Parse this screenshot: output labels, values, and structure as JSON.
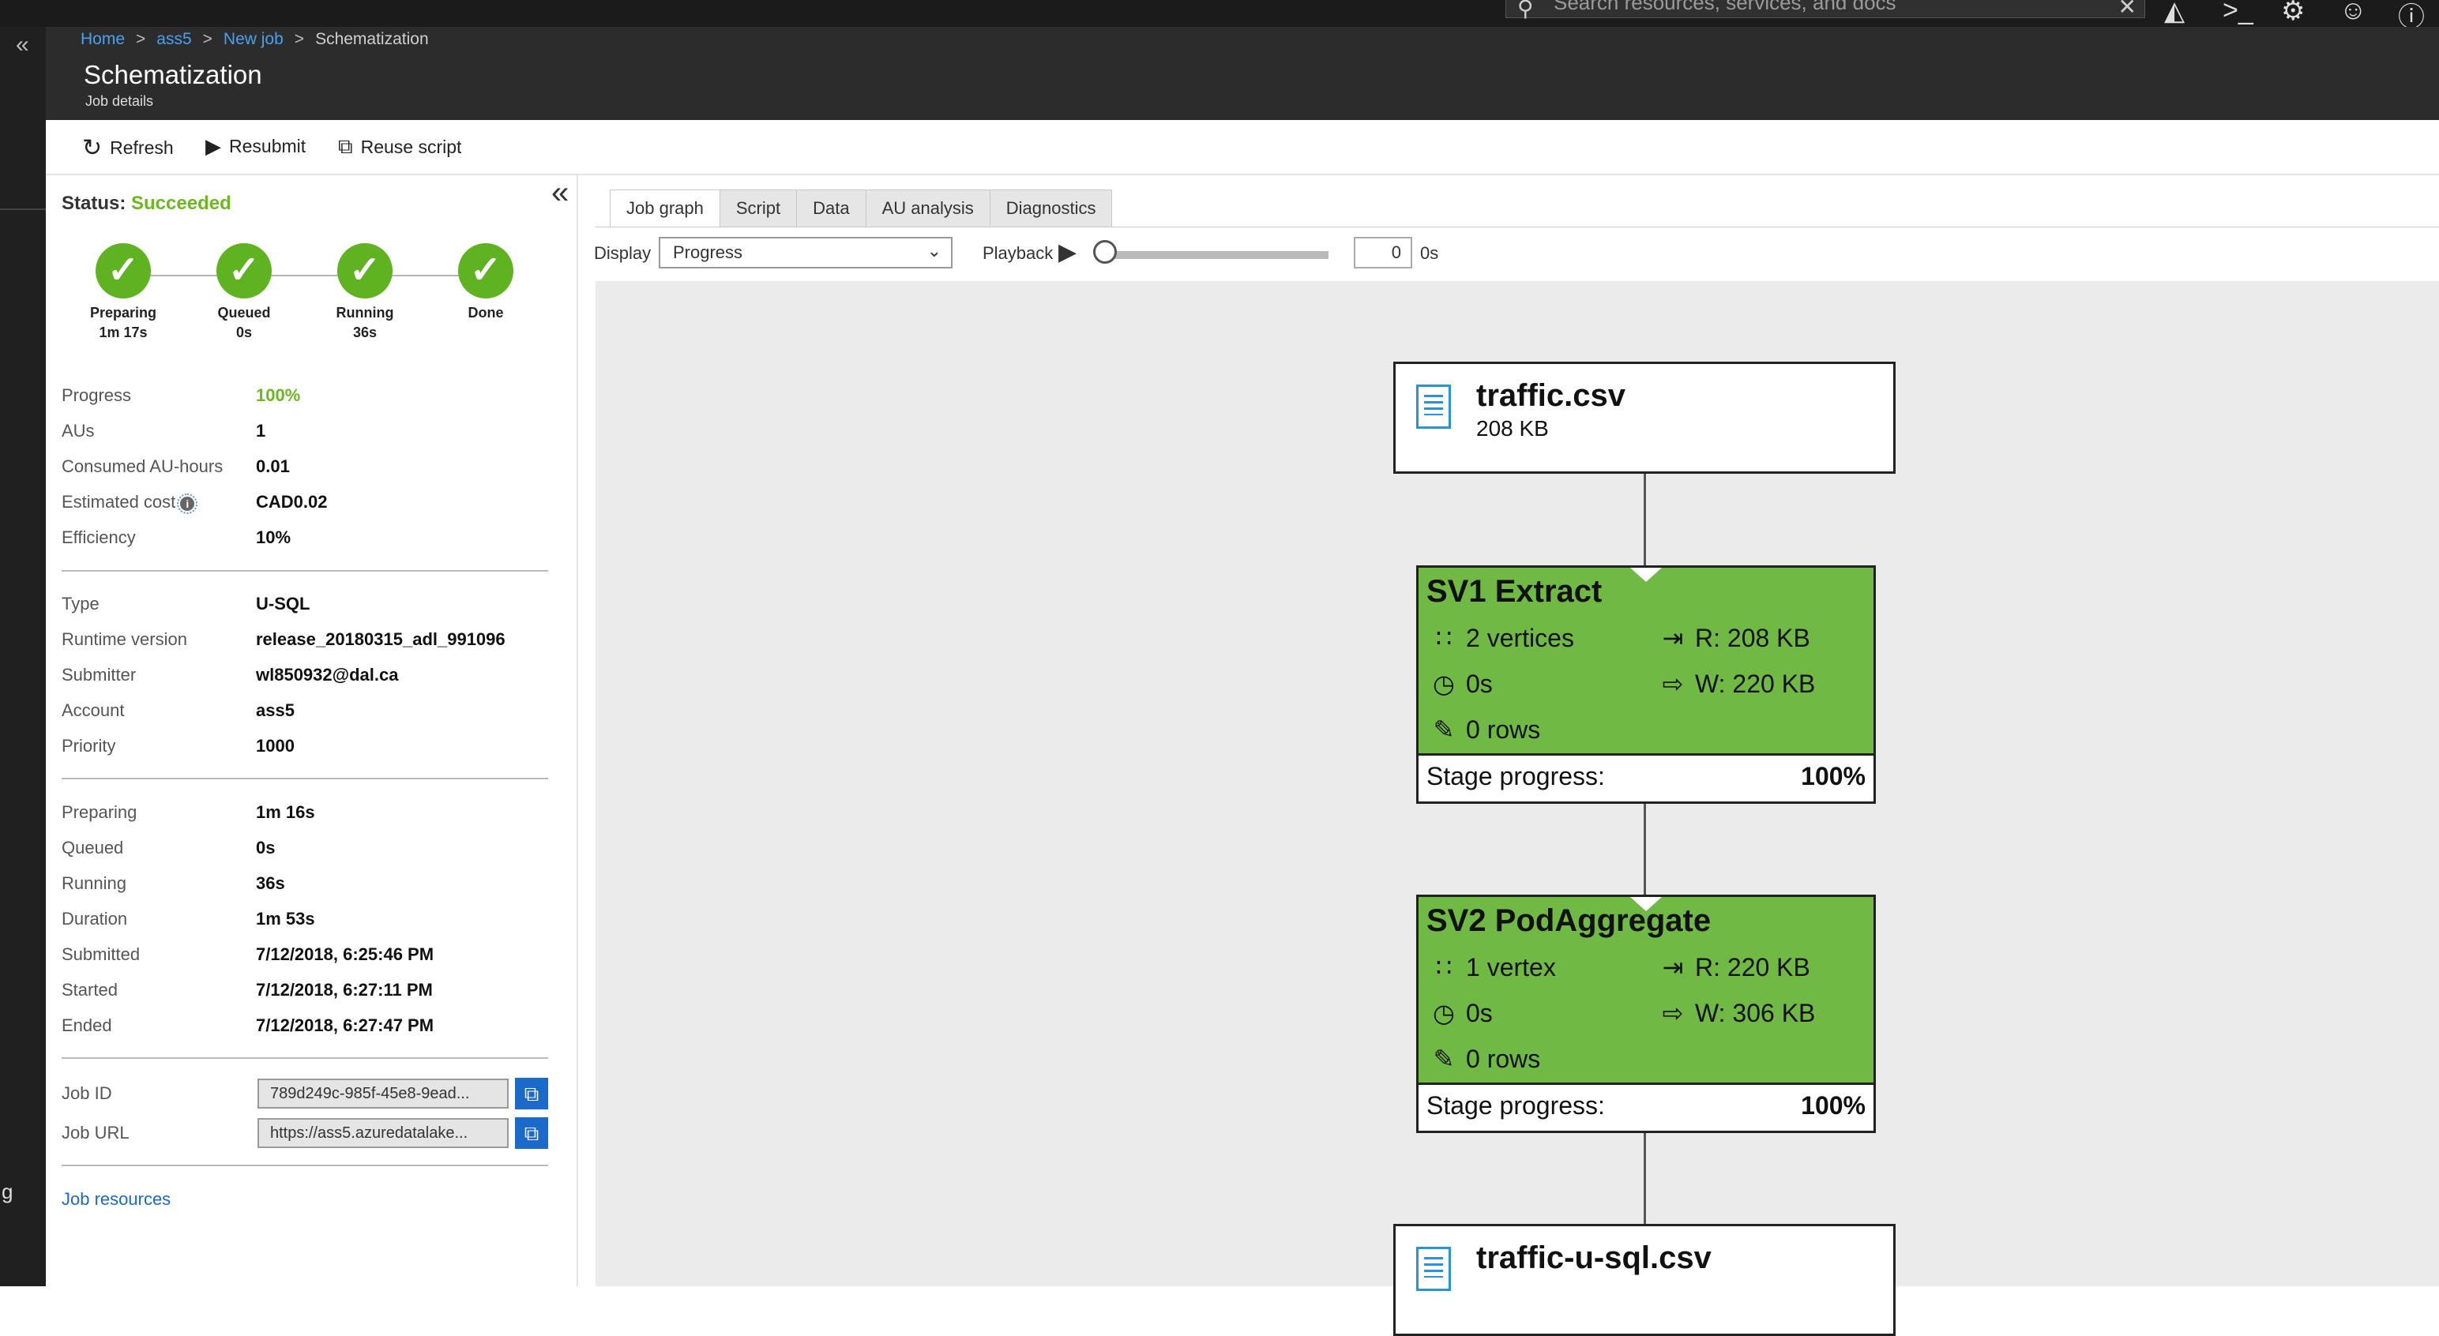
{
  "topbar": {
    "search_placeholder": "Search resources, services, and docs"
  },
  "breadcrumb": {
    "home": "Home",
    "account": "ass5",
    "newjob": "New job",
    "current": "Schematization"
  },
  "page": {
    "title": "Schematization",
    "subtitle": "Job details"
  },
  "toolbar": {
    "refresh": "Refresh",
    "resubmit": "Resubmit",
    "reuse": "Reuse script"
  },
  "status": {
    "label": "Status:",
    "value": "Succeeded"
  },
  "steps": [
    {
      "label": "Preparing",
      "time": "1m 17s"
    },
    {
      "label": "Queued",
      "time": "0s"
    },
    {
      "label": "Running",
      "time": "36s"
    },
    {
      "label": "Done",
      "time": ""
    }
  ],
  "summary": {
    "progress_k": "Progress",
    "progress_v": "100%",
    "aus_k": "AUs",
    "aus_v": "1",
    "consumed_k": "Consumed AU-hours",
    "consumed_v": "0.01",
    "cost_k": "Estimated cost",
    "cost_v": "CAD0.02",
    "eff_k": "Efficiency",
    "eff_v": "10%"
  },
  "details": {
    "type_k": "Type",
    "type_v": "U-SQL",
    "runtime_k": "Runtime version",
    "runtime_v": "release_20180315_adl_991096",
    "submitter_k": "Submitter",
    "submitter_v": "wl850932@dal.ca",
    "account_k": "Account",
    "account_v": "ass5",
    "priority_k": "Priority",
    "priority_v": "1000"
  },
  "timing": {
    "preparing_k": "Preparing",
    "preparing_v": "1m 16s",
    "queued_k": "Queued",
    "queued_v": "0s",
    "running_k": "Running",
    "running_v": "36s",
    "duration_k": "Duration",
    "duration_v": "1m 53s",
    "submitted_k": "Submitted",
    "submitted_v": "7/12/2018, 6:25:46 PM",
    "started_k": "Started",
    "started_v": "7/12/2018, 6:27:11 PM",
    "ended_k": "Ended",
    "ended_v": "7/12/2018, 6:27:47 PM"
  },
  "ids": {
    "jobid_k": "Job ID",
    "jobid_v": "789d249c-985f-45e8-9ead...",
    "joburl_k": "Job URL",
    "joburl_v": "https://ass5.azuredatalake..."
  },
  "job_resources": "Job resources",
  "tabs": [
    "Job graph",
    "Script",
    "Data",
    "AU analysis",
    "Diagnostics"
  ],
  "display": {
    "label": "Display",
    "value": "Progress",
    "playback_label": "Playback",
    "playback_value": "0",
    "playback_unit": "0s"
  },
  "graph": {
    "input_file": {
      "name": "traffic.csv",
      "size": "208 KB"
    },
    "stages": [
      {
        "name": "SV1 Extract",
        "vertices": "2 vertices",
        "time": "0s",
        "rows": "0 rows",
        "read": "R: 208 KB",
        "write": "W: 220 KB",
        "progress_label": "Stage progress:",
        "progress": "100%"
      },
      {
        "name": "SV2 PodAggregate",
        "vertices": "1 vertex",
        "time": "0s",
        "rows": "0 rows",
        "read": "R: 220 KB",
        "write": "W: 306 KB",
        "progress_label": "Stage progress:",
        "progress": "100%"
      }
    ],
    "output_file": {
      "name": "traffic-u-sql.csv"
    }
  },
  "colors": {
    "accent_link": "#4aa0f0",
    "success": "#6cb81f",
    "stage_fill": "#70b944",
    "copy_button": "#1b6ac9"
  }
}
